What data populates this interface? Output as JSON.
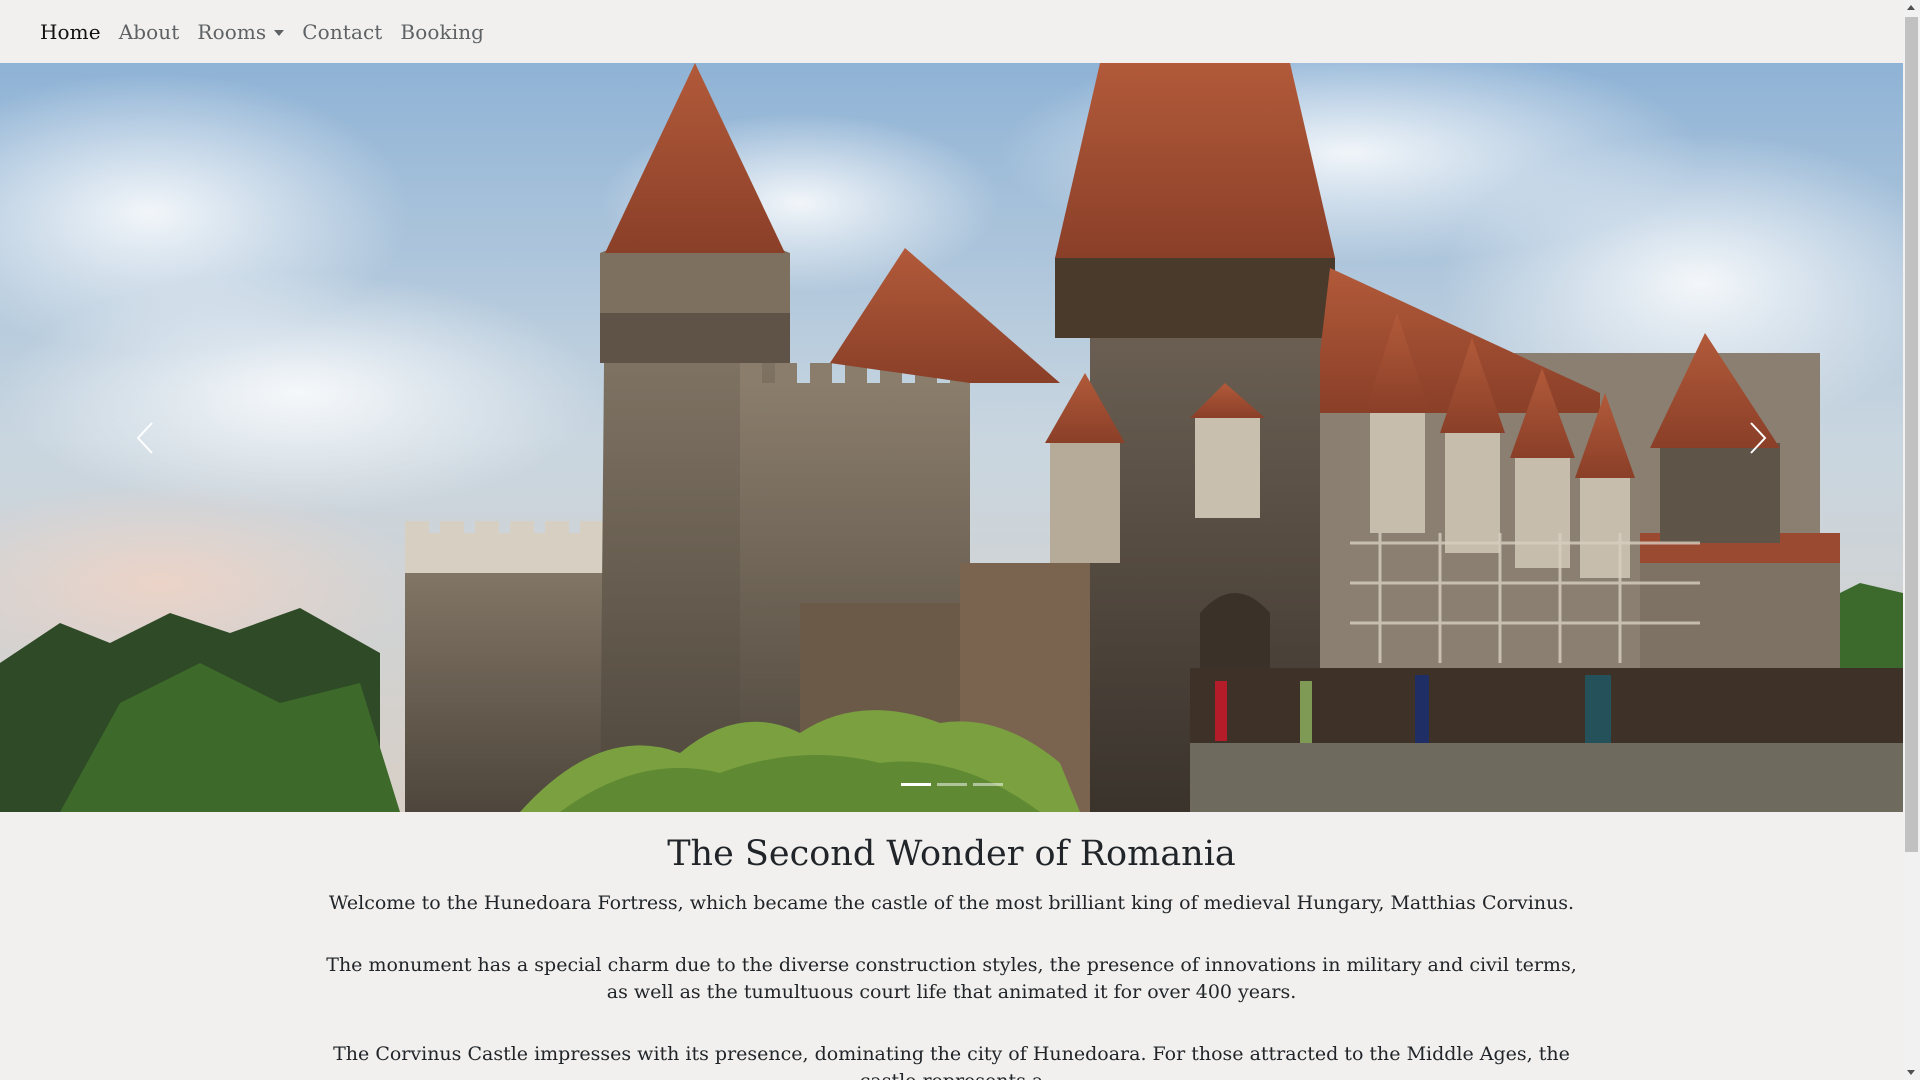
{
  "nav": {
    "items": [
      {
        "label": "Home",
        "active": true
      },
      {
        "label": "About"
      },
      {
        "label": "Rooms",
        "dropdown": true
      },
      {
        "label": "Contact"
      },
      {
        "label": "Booking"
      }
    ]
  },
  "carousel": {
    "image": "Corvin Castle (Hunedoara Fortress) photograph",
    "prev_icon": "chevron-left-icon",
    "next_icon": "chevron-right-icon",
    "slide_count": 3,
    "active_slide": 1
  },
  "content": {
    "heading": "The Second Wonder of Romania",
    "paragraphs": [
      "Welcome to the Hunedoara Fortress, which became the castle of the most brilliant king of medieval Hungary, Matthias Corvinus.",
      "The monument has a special charm due to the diverse construction styles, the presence of innovations in military and civil terms, as well as the tumultuous court life that animated it for over 400 years.",
      "The Corvinus Castle impresses with its presence, dominating the city of Hunedoara. For those attracted to the Middle Ages, the castle represents a"
    ]
  },
  "colors": {
    "background": "#f1f0ee",
    "text": "#212529",
    "nav_link": "#5f6265",
    "nav_active": "#111111"
  }
}
